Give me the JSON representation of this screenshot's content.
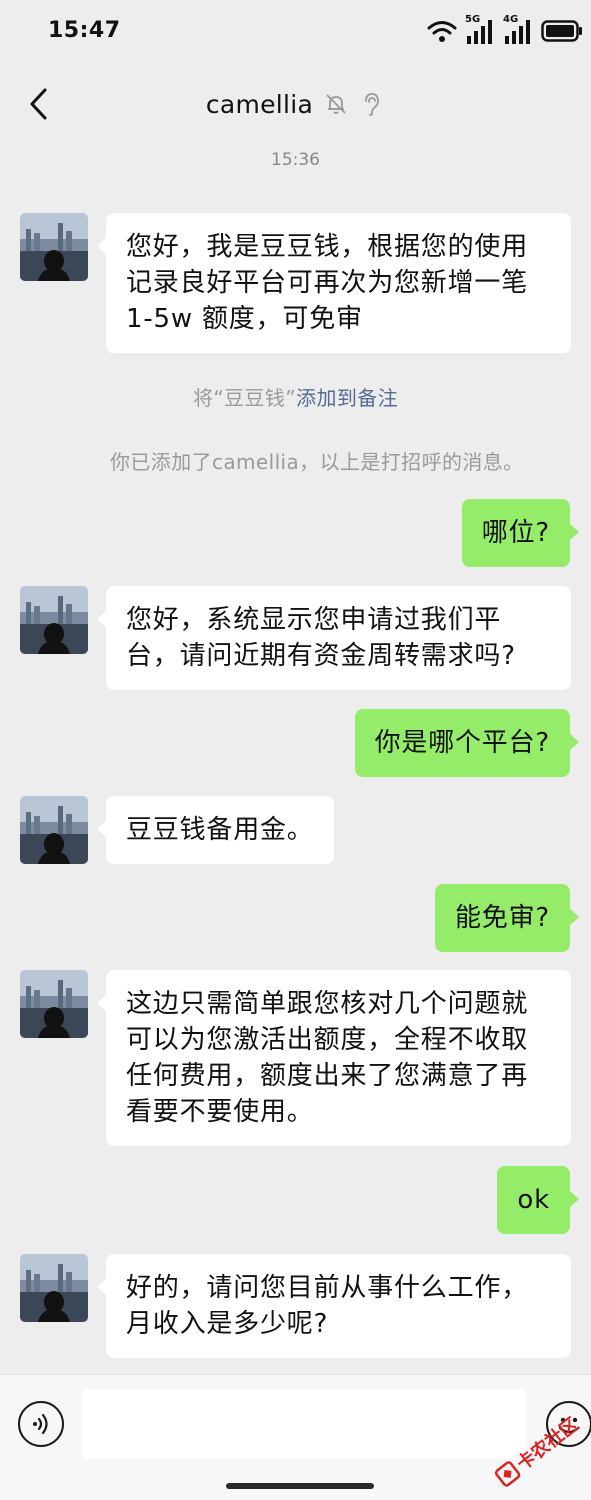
{
  "status_bar": {
    "time": "15:47",
    "icons": [
      "wifi-icon",
      "signal-5g-icon",
      "signal-4g-icon",
      "battery-icon"
    ],
    "network_1": "5G",
    "network_2": "4G"
  },
  "header": {
    "title": "camellia",
    "back_icon": "chevron-left-icon",
    "muted_icon": "bell-off-icon",
    "ear_icon": "ear-icon"
  },
  "chat": {
    "timestamp": "15:36",
    "messages": [
      {
        "from": "them",
        "text": "您好，我是豆豆钱，根据您的使用\n记录良好平台可再次为您新增一笔\n1-5w 额度，可免审"
      },
      {
        "from": "me",
        "text": "哪位?"
      },
      {
        "from": "them",
        "text": "您好，系统显示您申请过我们平\n台，请问近期有资金周转需求吗?"
      },
      {
        "from": "me",
        "text": "你是哪个平台?"
      },
      {
        "from": "them",
        "text": "豆豆钱备用金。"
      },
      {
        "from": "me",
        "text": "能免审?"
      },
      {
        "from": "them",
        "text": "这边只需简单跟您核对几个问题就\n可以为您激活出额度，全程不收取\n任何费用，额度出来了您满意了再\n看要不要使用。"
      },
      {
        "from": "me",
        "text": "ok"
      },
      {
        "from": "them",
        "text": "好的，请问您目前从事什么工作，\n月收入是多少呢?"
      }
    ],
    "system_note_prefix": "将“豆豆钱”",
    "system_note_link": "添加到备注",
    "system_added": "你已添加了camellia，以上是打招呼的消息。"
  },
  "input_bar": {
    "input_value": "",
    "voice_icon": "voice-icon",
    "emoji_icon": "emoji-icon"
  },
  "watermark": {
    "text": "卡农社区"
  },
  "colors": {
    "background": "#ededed",
    "incoming_bubble": "#ffffff",
    "outgoing_bubble": "#95ec69",
    "link": "#576b95",
    "system_text": "#9a9a9a"
  }
}
